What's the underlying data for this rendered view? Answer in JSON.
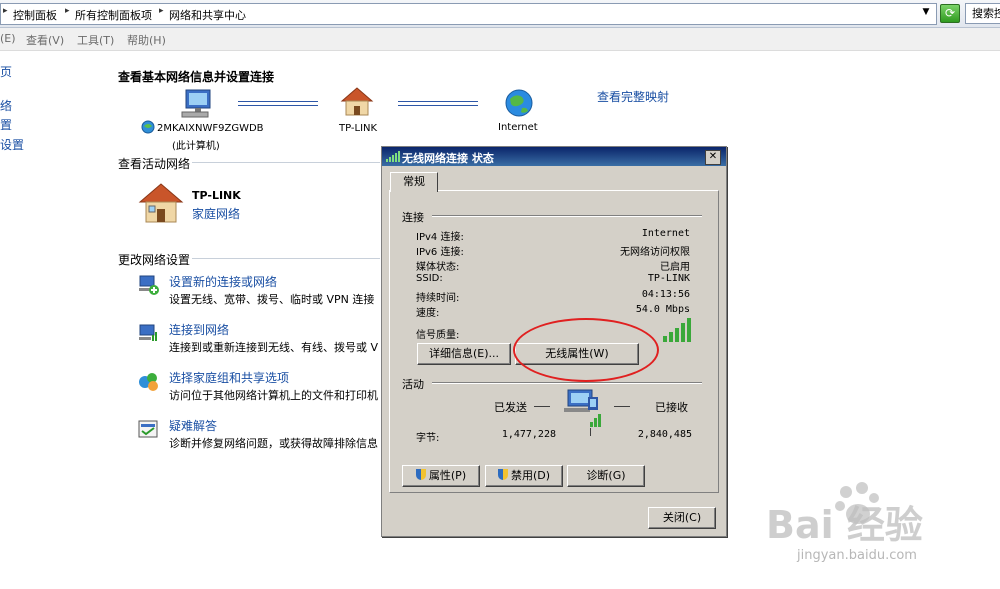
{
  "address_bar": {
    "crumbs": [
      "控制面板",
      "所有控制面板项",
      "网络和共享中心"
    ],
    "search_placeholder": "搜索控"
  },
  "menubar": [
    "(E)",
    "查看(V)",
    "工具(T)",
    "帮助(H)"
  ],
  "left_pane": [
    "页",
    "络",
    "置",
    "设置"
  ],
  "main": {
    "heading_basic": "查看基本网络信息并设置连接",
    "map": {
      "computer_name": "2MKAIXNWF9ZGWDB",
      "computer_sub": "(此计算机)",
      "router": "TP-LINK",
      "internet": "Internet",
      "full_map_link": "查看完整映射"
    },
    "active_heading": "查看活动网络",
    "active_network": {
      "name": "TP-LINK",
      "type": "家庭网络"
    },
    "change_heading": "更改网络设置",
    "tasks": [
      {
        "title": "设置新的连接或网络",
        "desc": "设置无线、宽带、拨号、临时或 VPN 连接"
      },
      {
        "title": "连接到网络",
        "desc": "连接到或重新连接到无线、有线、拨号或 V"
      },
      {
        "title": "选择家庭组和共享选项",
        "desc": "访问位于其他网络计算机上的文件和打印机"
      },
      {
        "title": "疑难解答",
        "desc": "诊断并修复网络问题，或获得故障排除信息"
      }
    ]
  },
  "dialog": {
    "title": "无线网络连接 状态",
    "tab": "常规",
    "connection_group": "连接",
    "rows": [
      {
        "label": "IPv4 连接:",
        "value": "Internet"
      },
      {
        "label": "IPv6 连接:",
        "value": "无网络访问权限"
      },
      {
        "label": "媒体状态:",
        "value": "已启用"
      },
      {
        "label": "SSID:",
        "value": "TP-LINK"
      },
      {
        "label": "持续时间:",
        "value": "04:13:56"
      },
      {
        "label": "速度:",
        "value": "54.0 Mbps"
      }
    ],
    "signal_label": "信号质量:",
    "signal_bars": 5,
    "details_button": "详细信息(E)...",
    "wireless_props_button": "无线属性(W)",
    "activity_group": "活动",
    "sent_label": "已发送",
    "received_label": "已接收",
    "bytes_label": "字节:",
    "bytes_sent": "1,477,228",
    "bytes_received": "2,840,485",
    "properties_button": "属性(P)",
    "disable_button": "禁用(D)",
    "diagnose_button": "诊断(G)",
    "close_button": "关闭(C)"
  },
  "watermark": {
    "brand": "Bai 经验",
    "url": "jingyan.baidu.com"
  },
  "colors": {
    "link": "#1a4fa3",
    "title_bar": "#0a246a",
    "highlight_circle": "#e02020"
  }
}
